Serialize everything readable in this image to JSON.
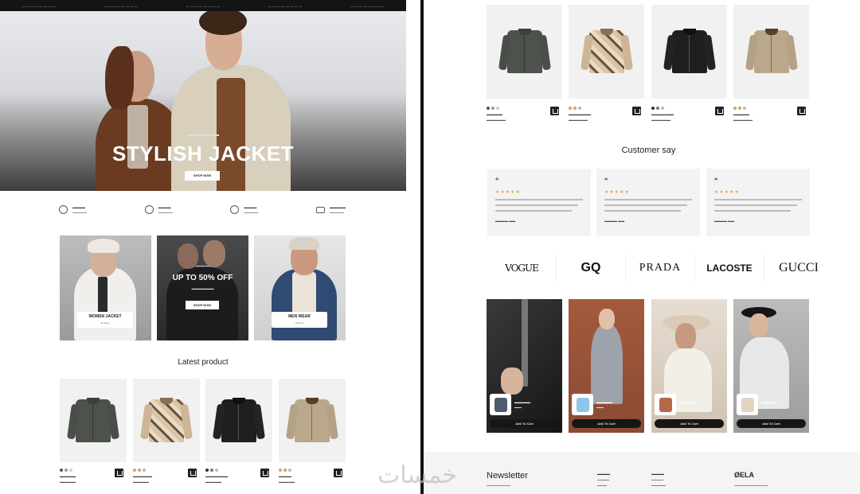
{
  "hero": {
    "title": "STYLISH JACKET",
    "button": "SHOP NOW"
  },
  "promos": {
    "left_label": "WOMEN JACKET",
    "left_sub": "11 items",
    "middle_title": "UP TO 50% OFF",
    "middle_button": "SHOP NOW",
    "right_label": "MEN WEAR",
    "right_sub": "8 items"
  },
  "latest": {
    "title": "Latest product"
  },
  "testimonials": {
    "title": "Customer say",
    "quote_mark": "“",
    "stars": "★★★★★"
  },
  "brands": [
    "VOGUE",
    "GQ",
    "PRADA",
    "LACOSTE",
    "GUCCI"
  ],
  "looks": {
    "button": "Add To Cart"
  },
  "footer": {
    "newsletter": "Newsletter",
    "logo": "ØELA"
  },
  "colors": {
    "jacket_green": "#4e524c",
    "jacket_camo": "#d9c4a6",
    "jacket_black": "#1f1f22",
    "jacket_beige": "#b9a88b",
    "star": "#f0a830"
  }
}
